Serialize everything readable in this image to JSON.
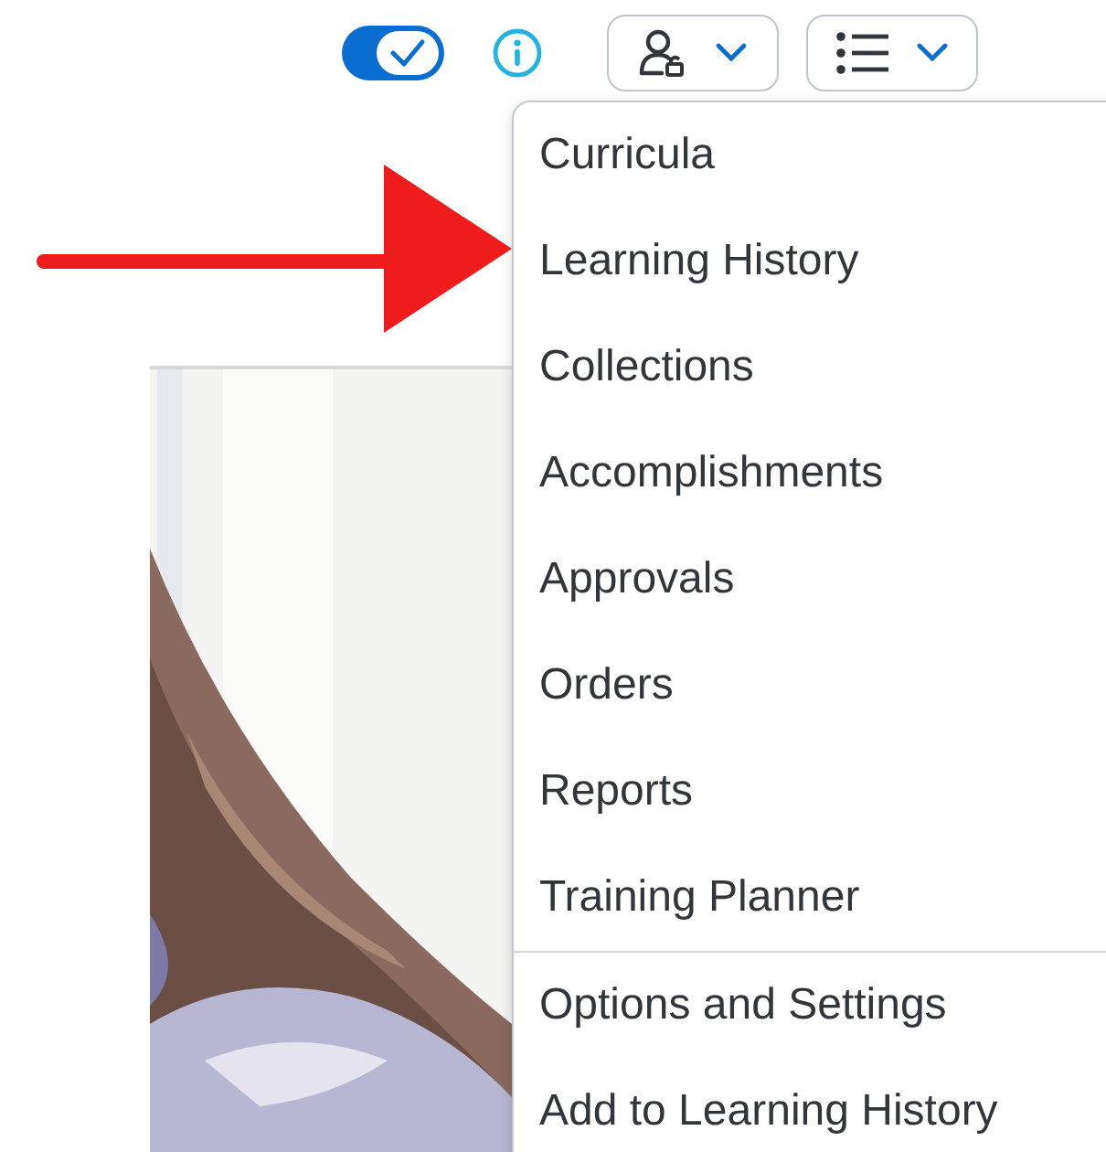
{
  "toolbar": {
    "toggle": {
      "on": true
    }
  },
  "menu": {
    "groups": [
      {
        "items": [
          "Curricula",
          "Learning History",
          "Collections",
          "Accomplishments",
          "Approvals",
          "Orders",
          "Reports",
          "Training Planner"
        ]
      },
      {
        "items": [
          "Options and Settings",
          "Add to Learning History"
        ]
      }
    ]
  }
}
